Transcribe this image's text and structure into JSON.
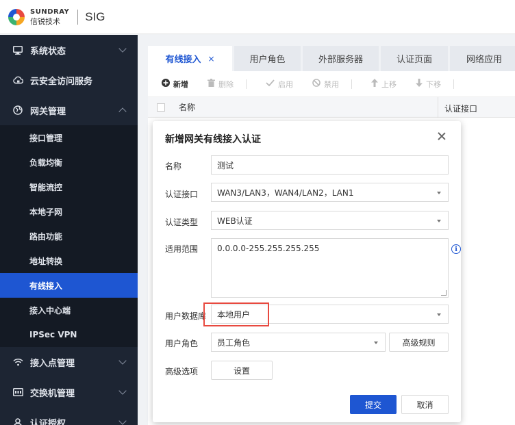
{
  "header": {
    "brand_en": "SUNDRAY",
    "brand_cn": "信锐技术",
    "product": "SIG"
  },
  "sidebar": {
    "groups": [
      {
        "label": "系统状态",
        "icon": "monitor-icon"
      },
      {
        "label": "云安全访问服务",
        "icon": "cloud-lock-icon"
      },
      {
        "label": "网关管理",
        "icon": "globe-icon"
      },
      {
        "label": "接入点管理",
        "icon": "wifi-icon"
      },
      {
        "label": "交换机管理",
        "icon": "switch-icon"
      },
      {
        "label": "认证授权",
        "icon": "auth-icon"
      }
    ],
    "sub_items": [
      "接口管理",
      "负载均衡",
      "智能流控",
      "本地子网",
      "路由功能",
      "地址转换",
      "有线接入",
      "接入中心端",
      "IPSec VPN"
    ],
    "active_sub": "有线接入"
  },
  "tabs": [
    {
      "label": "有线接入",
      "active": true,
      "close": "×"
    },
    {
      "label": "用户角色"
    },
    {
      "label": "外部服务器"
    },
    {
      "label": "认证页面"
    },
    {
      "label": "网络应用"
    }
  ],
  "toolbar": {
    "add": "新增",
    "delete": "删除",
    "enable": "启用",
    "disable": "禁用",
    "move_up": "上移",
    "move_down": "下移"
  },
  "table": {
    "columns": [
      "名称",
      "认证接口"
    ]
  },
  "dialog": {
    "title": "新增网关有线接入认证",
    "name_label": "名称",
    "name_value": "测试",
    "iface_label": "认证接口",
    "iface_value": "WAN3/LAN3，WAN4/LAN2，LAN1",
    "type_label": "认证类型",
    "type_value": "WEB认证",
    "scope_label": "适用范围",
    "scope_value": "0.0.0.0-255.255.255.255",
    "info_glyph": "i",
    "userdb_label": "用户数据库",
    "userdb_value": "本地用户",
    "role_label": "用户角色",
    "role_value": "员工角色",
    "adv_rule_button": "高级规则",
    "adv_opt_label": "高级选项",
    "settings_button": "设置",
    "submit_button": "提交",
    "cancel_button": "取消"
  },
  "colors": {
    "accent": "#1e56d2",
    "sidebar_bg": "#1d2533",
    "highlight": "#e8493f"
  }
}
